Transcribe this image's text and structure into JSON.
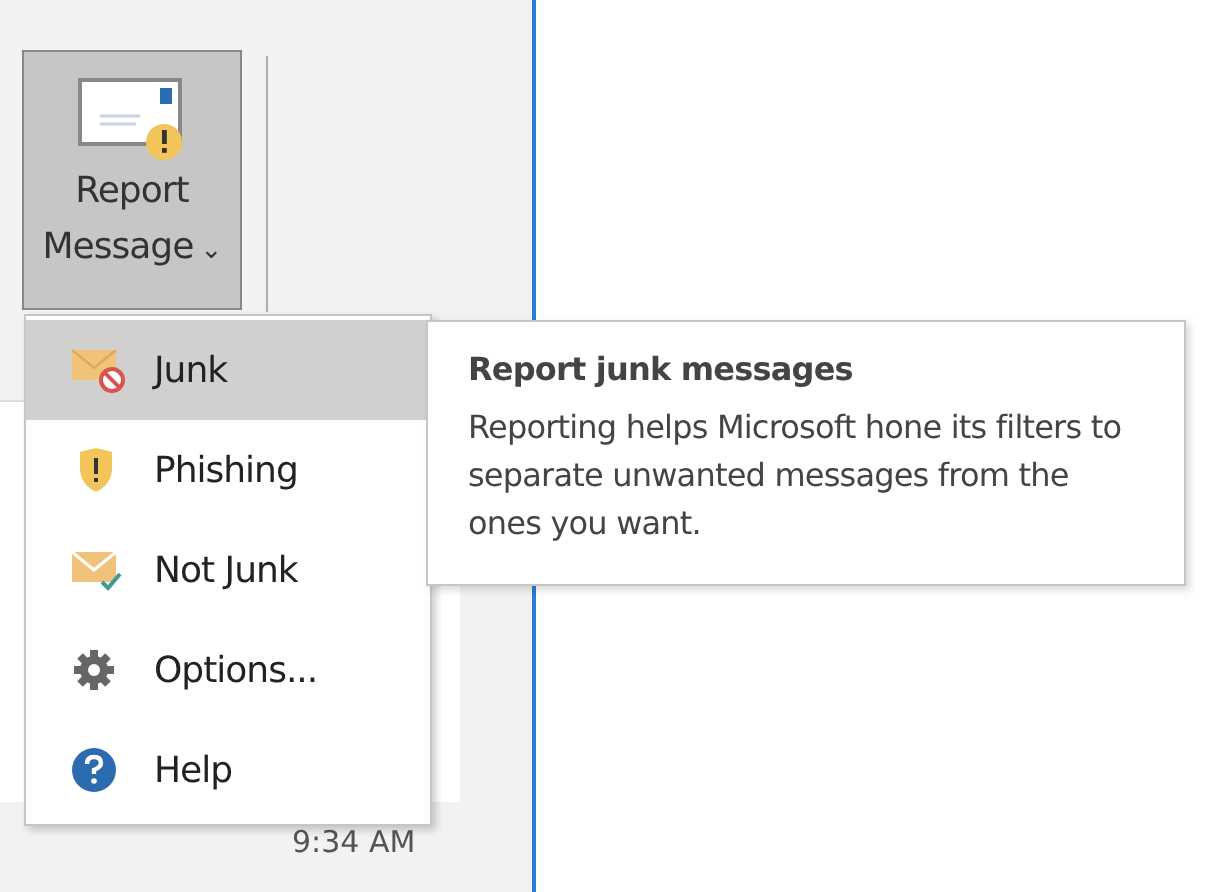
{
  "ribbon": {
    "button": {
      "label_line1": "Report",
      "label_line2": "Message",
      "pressed": true,
      "dropdown": "⌄"
    }
  },
  "menu": {
    "items": [
      {
        "label": "Junk",
        "kind": "junk",
        "selected": true
      },
      {
        "label": "Phishing",
        "kind": "phishing",
        "selected": false
      },
      {
        "label": "Not Junk",
        "kind": "notjunk",
        "selected": false
      },
      {
        "label": "Options...",
        "kind": "options",
        "selected": false
      },
      {
        "label": "Help",
        "kind": "help",
        "selected": false
      }
    ]
  },
  "tooltip": {
    "title": "Report junk messages",
    "body": "Reporting helps Microsoft hone its filters to separate unwanted messages from the ones you want."
  },
  "message_list": {
    "time": "9:34 AM"
  }
}
